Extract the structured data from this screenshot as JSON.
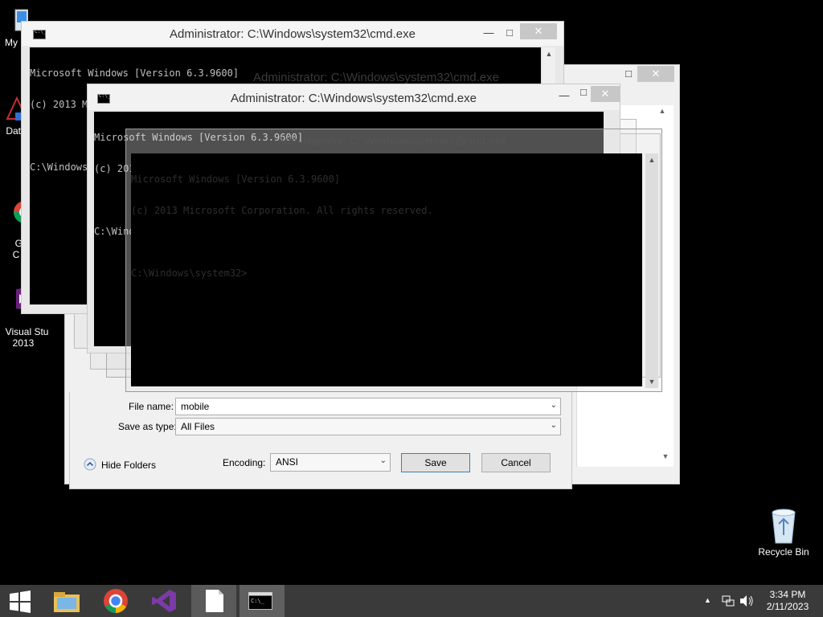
{
  "desktop": {
    "icons": [
      {
        "label": "My C"
      },
      {
        "label": "Data"
      },
      {
        "label": "G\nC"
      },
      {
        "label": "Visual Stu\n2013"
      }
    ],
    "recycle_bin": {
      "label": "Recycle Bin"
    }
  },
  "windows": {
    "back_window": {
      "title": "Administrator: C:\\Windows\\system32\\cmd.exe"
    },
    "mid_window": {
      "title": "Administrator: C:\\Windows\\system32\\cmd.exe"
    },
    "front_window": {
      "title": "Administrator: C:\\Windows\\system32\\cmd.exe"
    },
    "console_lines": [
      "Microsoft Windows [Version 6.3.9600]",
      "(c) 2013 Microsoft Corporation. All rights reserved.",
      "",
      "C:\\Windows\\system32>"
    ]
  },
  "save_dialog": {
    "file_name_label": "File name:",
    "file_name_value": "mobile",
    "save_as_type_label": "Save as type:",
    "save_as_type_value": "All Files",
    "hide_folders_label": "Hide Folders",
    "encoding_label": "Encoding:",
    "encoding_value": "ANSI",
    "save_label": "Save",
    "cancel_label": "Cancel"
  },
  "taskbar": {
    "time": "3:34 PM",
    "date": "2/11/2023",
    "items": [
      "start-button",
      "file-explorer",
      "chrome",
      "visual-studio",
      "notepad",
      "cmd"
    ]
  },
  "colors": {
    "desktop": "#000000",
    "taskbar": "#3a3a3a",
    "console_text": "#c0c0c0",
    "accent_blue": "#3c7fb1"
  }
}
